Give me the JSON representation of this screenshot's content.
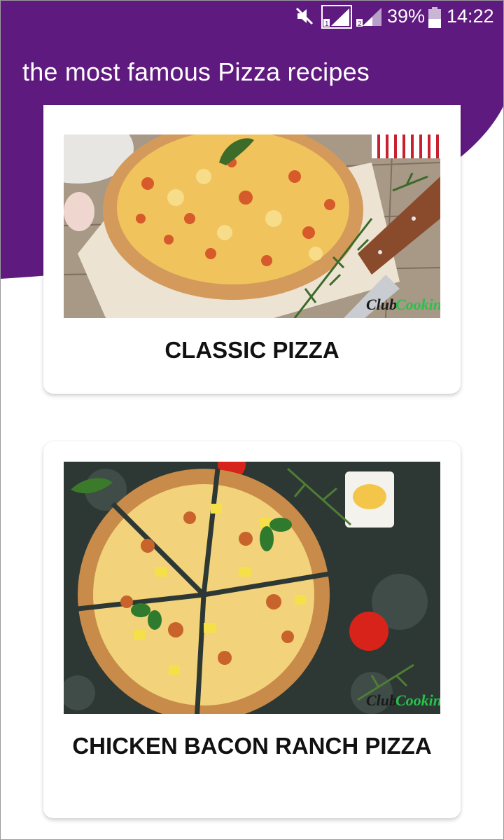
{
  "status_bar": {
    "icons": [
      "mute-icon",
      "sim1-signal-icon",
      "sim2-signal-icon",
      "battery-icon"
    ],
    "battery": "39%",
    "time": "14:22"
  },
  "app_bar": {
    "title": "the most famous Pizza recipes",
    "color": "#5f1a7f"
  },
  "recipes": [
    {
      "title": "CLASSIC PIZZA",
      "image": "classic-pizza-photo",
      "watermark_a": "Club",
      "watermark_b": "Cooking"
    },
    {
      "title": "CHICKEN BACON RANCH PIZZA",
      "image": "chicken-bacon-ranch-pizza-photo",
      "watermark_a": "Club",
      "watermark_b": "Cooking"
    }
  ]
}
